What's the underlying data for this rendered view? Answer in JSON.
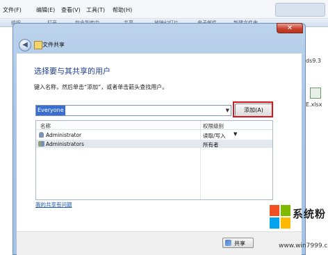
{
  "menubar": {
    "items": [
      "文件(F)",
      "编辑(E)",
      "查看(V)",
      "工具(T)",
      "帮助(H)"
    ]
  },
  "toolbar": {
    "ghost_items": [
      "组织",
      "打开",
      "包含到库中",
      "共享",
      "放映幻灯片",
      "电子邮件",
      "新建文件夹"
    ]
  },
  "background_files": {
    "items": [
      "ds9.3",
      "E.xlsx"
    ]
  },
  "dialog": {
    "close_symbol": "✕",
    "back_symbol": "◀",
    "wizard_title": "文件共享",
    "heading": "选择要与其共享的用户",
    "instruction": "键入名称，然后单击“添加”，或者单击箭头查找用户。",
    "combo_value": "Everyone",
    "combo_arrow": "▼",
    "add_button_label": "添加(A)",
    "columns": {
      "name": "名称",
      "level": "权限级别"
    },
    "rows": [
      {
        "name": "Administrator",
        "permission": "读取/写入",
        "arrow": "▼",
        "icon": "user-icon",
        "selected": false
      },
      {
        "name": "Administrators",
        "permission": "所有者",
        "arrow": "",
        "icon": "group-icon",
        "selected": true
      }
    ],
    "help_link": "我的共享有问题",
    "share_button_label": "共享"
  },
  "watermark": {
    "brand": "系统粉",
    "url": "www.win7999.com",
    "colors": [
      "#f25022",
      "#7fba00",
      "#00a4ef",
      "#ffb900"
    ]
  },
  "colors": {
    "heading": "#1e3e99",
    "highlight_box": "#d9141b",
    "link": "#1a55b8"
  }
}
